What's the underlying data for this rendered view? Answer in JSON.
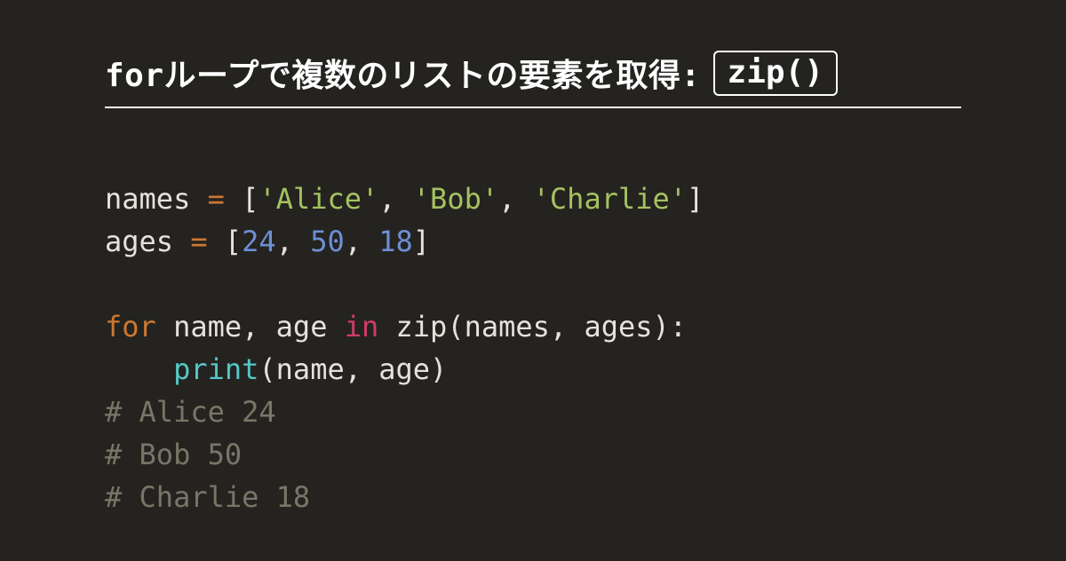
{
  "title": {
    "text": "forループで複数のリストの要素を取得: ",
    "boxed": "zip()"
  },
  "code": {
    "l1": {
      "var": "names",
      "eq": " = ",
      "open": "[",
      "s1": "'Alice'",
      "c1": ", ",
      "s2": "'Bob'",
      "c2": ", ",
      "s3": "'Charlie'",
      "close": "]"
    },
    "l2": {
      "var": "ages",
      "eq": " = ",
      "open": "[",
      "n1": "24",
      "c1": ", ",
      "n2": "50",
      "c2": ", ",
      "n3": "18",
      "close": "]"
    },
    "l3": "",
    "l4": {
      "for": "for",
      "vars": " name, age ",
      "in": "in",
      "call": " zip(names, ages):"
    },
    "l5": {
      "indent": "    ",
      "fn": "print",
      "args": "(name, age)"
    },
    "l6": "# Alice 24",
    "l7": "# Bob 50",
    "l8": "# Charlie 18"
  }
}
